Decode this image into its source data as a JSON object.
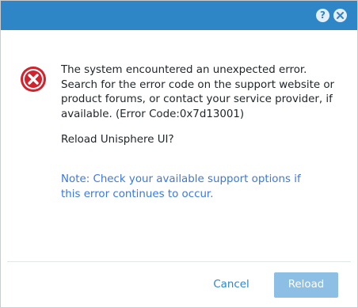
{
  "title_bar": {
    "help_glyph": "?",
    "help_icon": "help-icon",
    "close_icon": "close-icon",
    "accent_color": "#2f86c7"
  },
  "error": {
    "icon": "error-icon",
    "icon_color": "#d0232d",
    "message": "The system encountered an unexpected error. Search for the error code on the support website or product forums, or contact your service provider, if available. (Error Code:0x7d13001)",
    "question": "Reload Unisphere UI?",
    "note": "Note: Check your available support options if this error continues to occur."
  },
  "footer": {
    "cancel_label": "Cancel",
    "reload_label": "Reload"
  }
}
